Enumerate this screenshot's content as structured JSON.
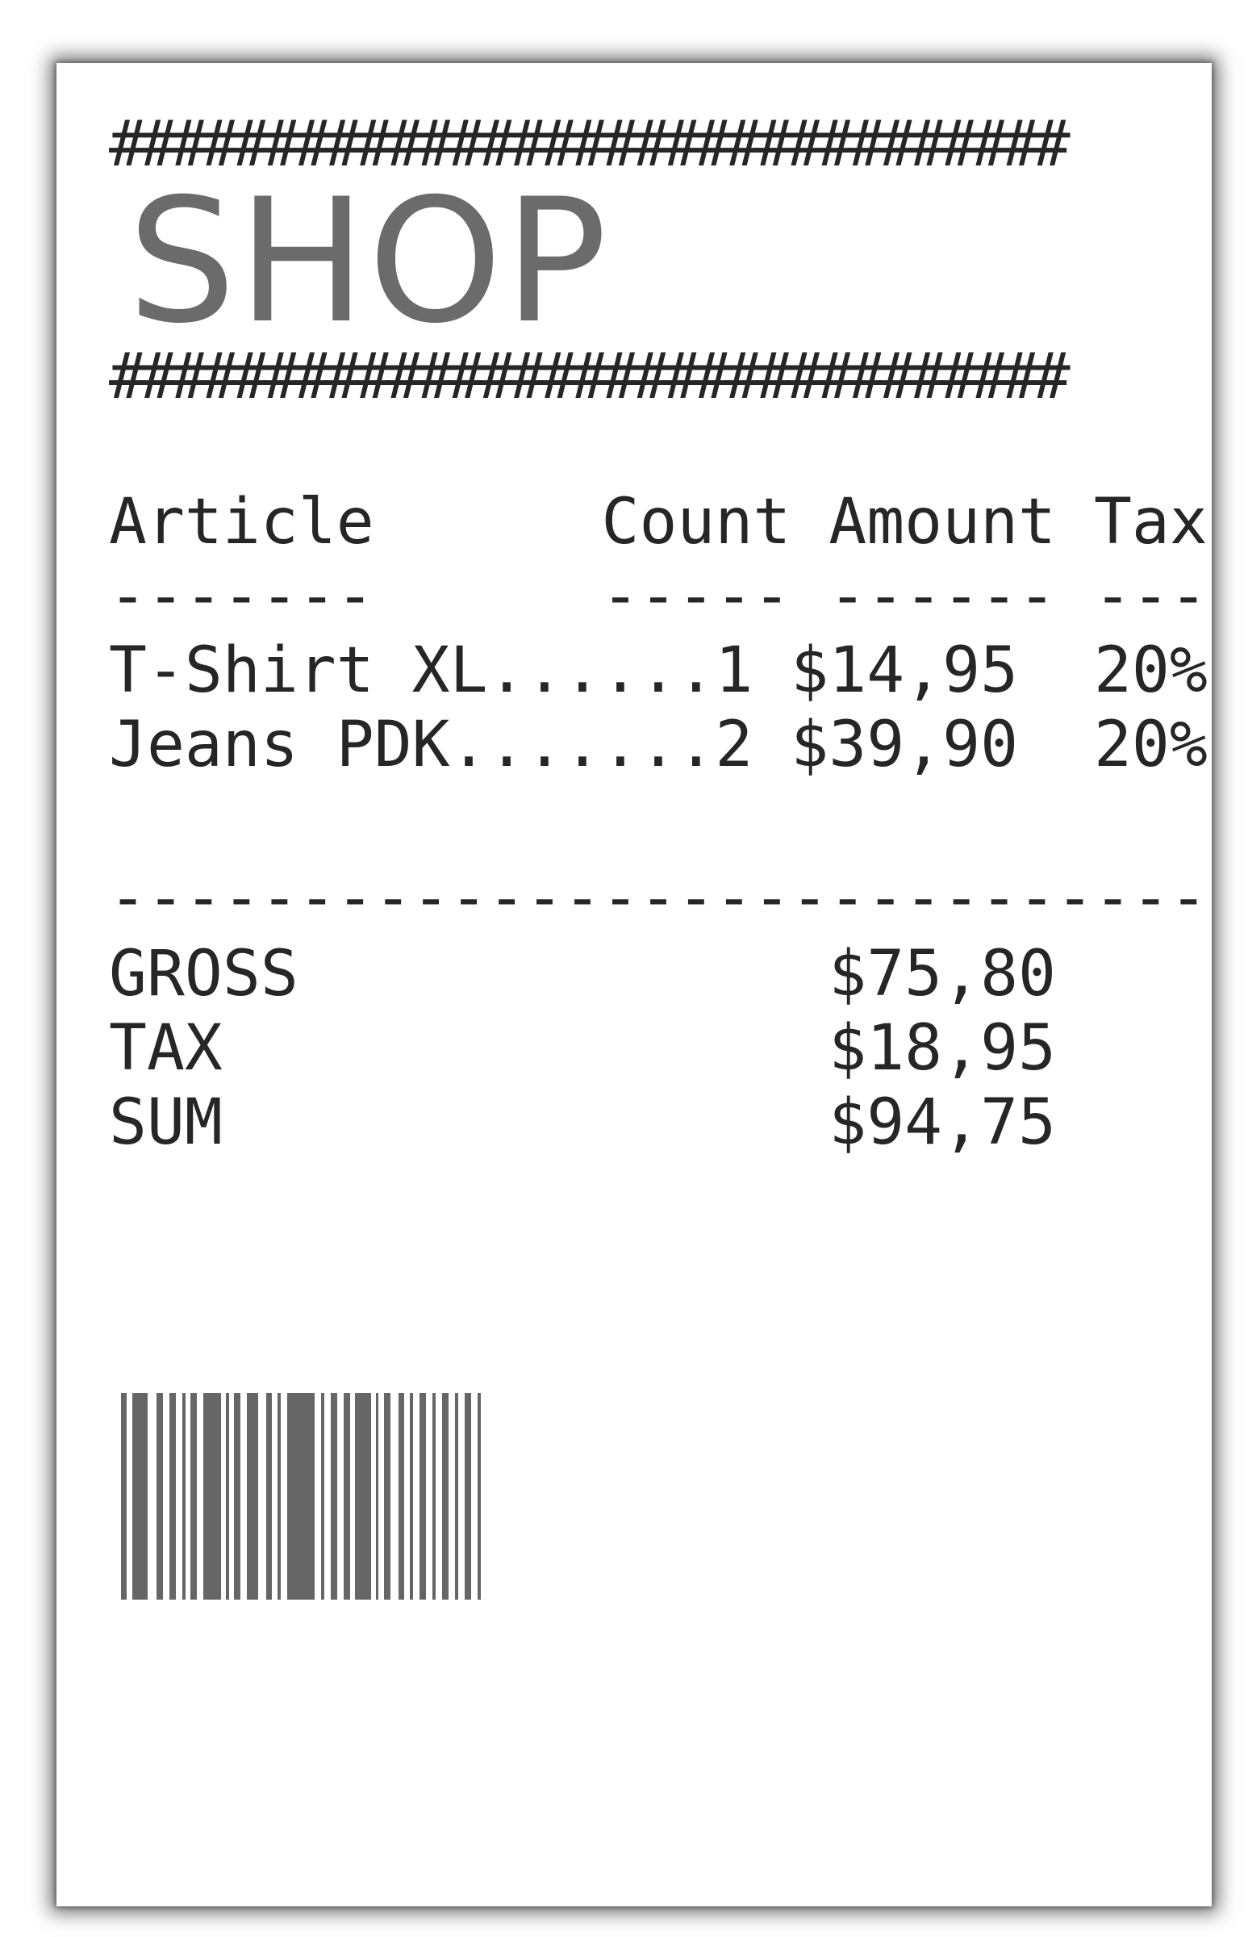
{
  "receipt": {
    "hash_rule_top": "###############################",
    "hash_rule_bottom": "###############################",
    "shop_name": "SHOP",
    "header_line": "Article      Count Amount Tax",
    "header_underline": "-------      ----- ------ ---",
    "items": [
      "T-Shirt XL......1 $14,95  20%",
      "Jeans PDK.......2 $39,90  20%"
    ],
    "separator": "-----------------------------",
    "totals": [
      "GROSS              $75,80",
      "TAX                $18,95",
      "SUM                $94,75"
    ]
  },
  "colors": {
    "text": "#262626",
    "shop_name": "#6b6b6b",
    "barcode": "#666666",
    "paper": "#ffffff"
  }
}
